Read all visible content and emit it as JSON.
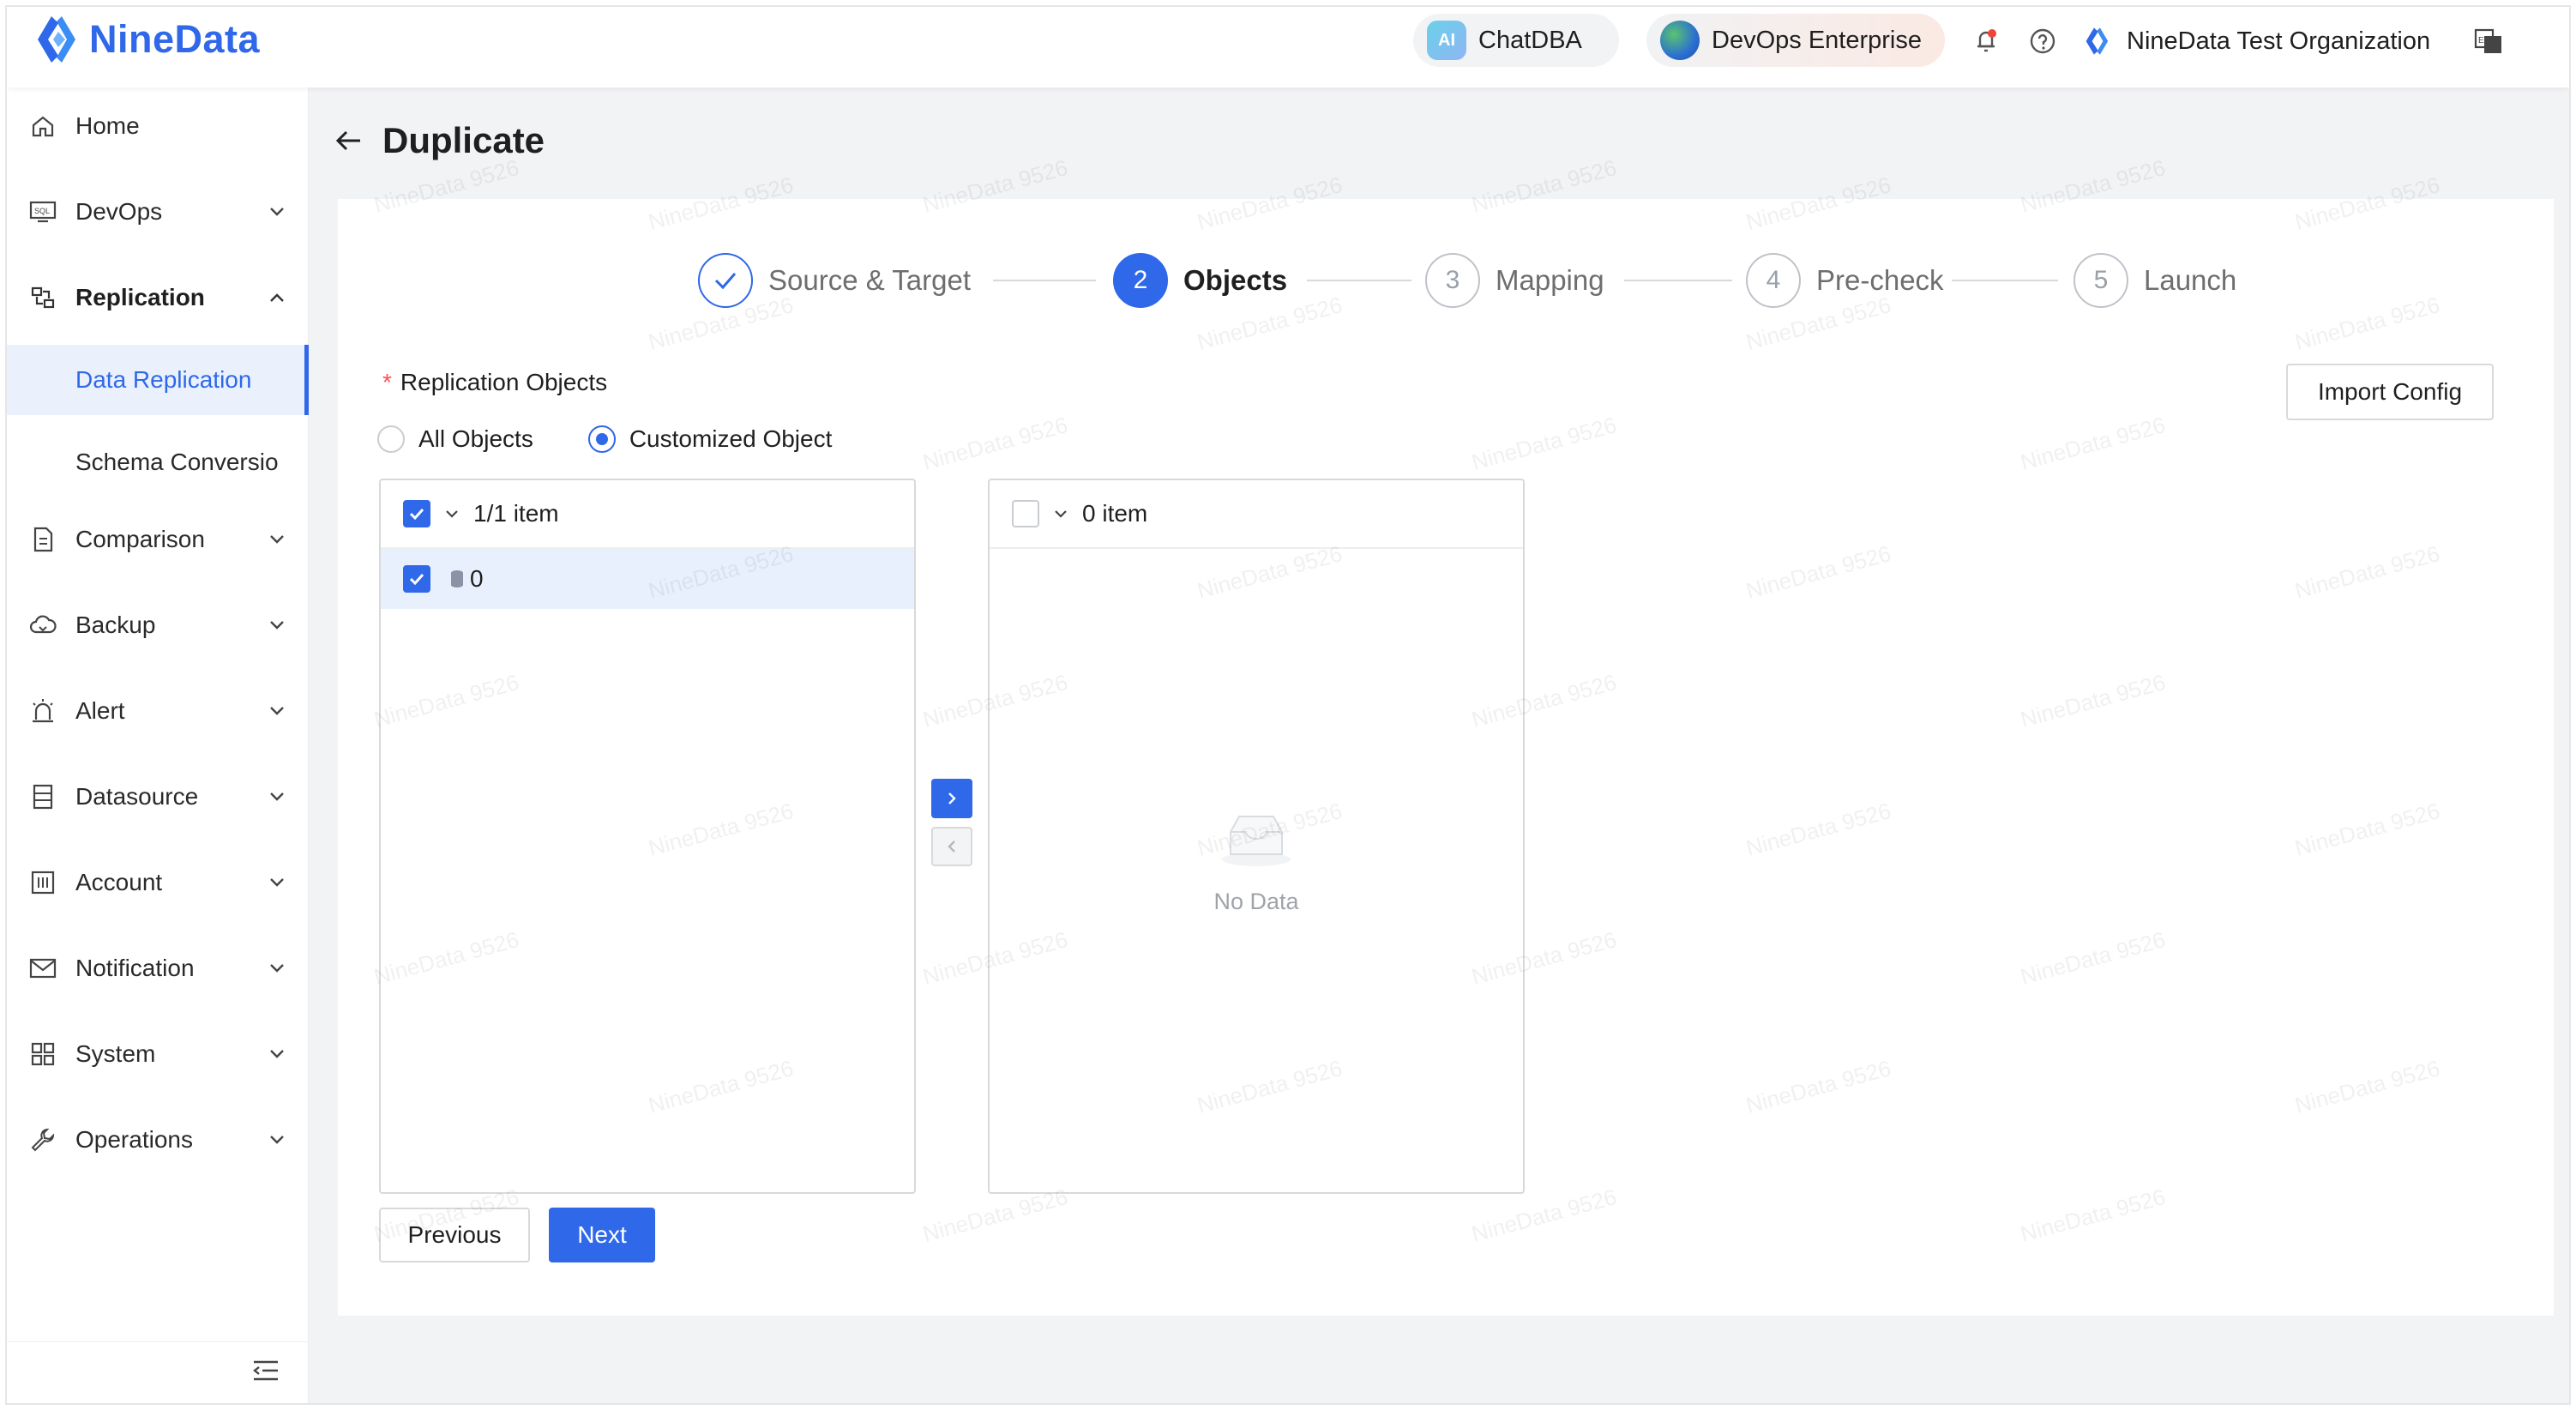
{
  "brand": {
    "name": "NineData",
    "color": "#2f68e8"
  },
  "topbar": {
    "chat_label": "ChatDBA",
    "chat_icon": "ai-icon",
    "edition_label": "DevOps Enterprise",
    "edition_icon": "globe-icon",
    "org_name": "NineData Test Organization"
  },
  "sidebar": {
    "items": [
      {
        "label": "Home",
        "icon": "home-icon"
      },
      {
        "label": "DevOps",
        "icon": "sql-icon"
      },
      {
        "label": "Replication",
        "icon": "replication-icon"
      },
      {
        "label": "Data Replication"
      },
      {
        "label": "Schema Conversio"
      },
      {
        "label": "Comparison",
        "icon": "comparison-icon"
      },
      {
        "label": "Backup",
        "icon": "cloud-icon"
      },
      {
        "label": "Alert",
        "icon": "alarm-icon"
      },
      {
        "label": "Datasource",
        "icon": "datasource-icon"
      },
      {
        "label": "Account",
        "icon": "account-icon"
      },
      {
        "label": "Notification",
        "icon": "mail-icon"
      },
      {
        "label": "System",
        "icon": "grid-icon"
      },
      {
        "label": "Operations",
        "icon": "wrench-icon"
      }
    ]
  },
  "page": {
    "title": "Duplicate"
  },
  "steps": [
    {
      "num": "1",
      "label": "Source & Target",
      "state": "done"
    },
    {
      "num": "2",
      "label": "Objects",
      "state": "current"
    },
    {
      "num": "3",
      "label": "Mapping",
      "state": "pending"
    },
    {
      "num": "4",
      "label": "Pre-check",
      "state": "pending"
    },
    {
      "num": "5",
      "label": "Launch",
      "state": "pending"
    }
  ],
  "form": {
    "field_label": "Replication Objects",
    "required_mark": "*",
    "import_label": "Import Config",
    "radio_all": "All Objects",
    "radio_custom": "Customized Object",
    "selected_option": "Customized Object"
  },
  "transfer": {
    "left": {
      "count_label": "1/1 item",
      "rows": [
        {
          "label": "0",
          "checked": true
        }
      ]
    },
    "right": {
      "count_label": "0 item",
      "empty_text": "No Data"
    }
  },
  "actions": {
    "previous": "Previous",
    "next": "Next"
  },
  "watermark": "NineData 9526"
}
